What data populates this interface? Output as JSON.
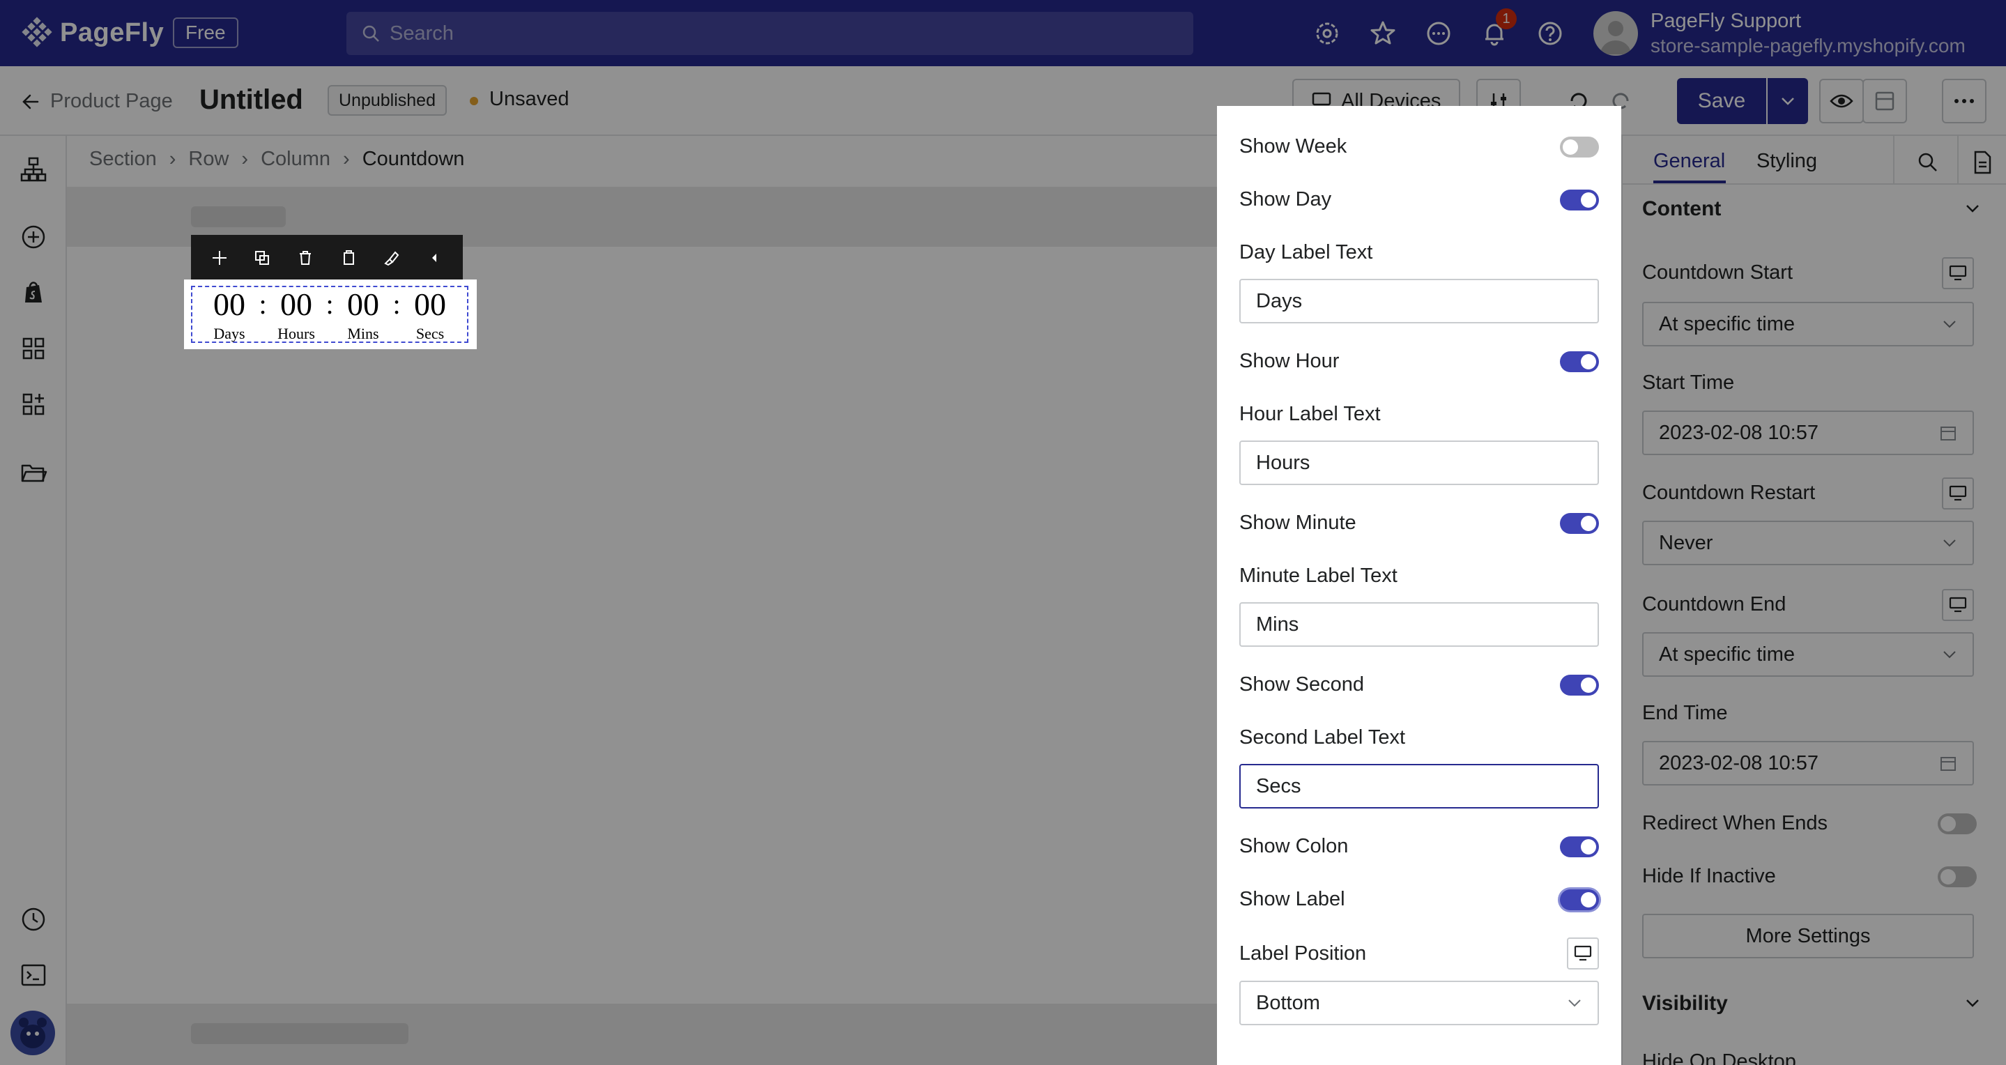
{
  "topbar": {
    "logo_text": "PageFly",
    "plan_badge": "Free",
    "search_placeholder": "Search",
    "notification_count": "1",
    "user_name": "PageFly Support",
    "user_store": "store-sample-pagefly.myshopify.com"
  },
  "subbar": {
    "back_label": "Product Page",
    "page_title": "Untitled",
    "status": "Unpublished",
    "save_state": "Unsaved",
    "devices_label": "All Devices",
    "save_label": "Save"
  },
  "breadcrumb": [
    "Section",
    "Row",
    "Column",
    "Countdown"
  ],
  "countdown": {
    "units": [
      {
        "value": "00",
        "label": "Days"
      },
      {
        "value": "00",
        "label": "Hours"
      },
      {
        "value": "00",
        "label": "Mins"
      },
      {
        "value": "00",
        "label": "Secs"
      }
    ],
    "separator": ":"
  },
  "popover": {
    "show_week": "Show Week",
    "show_day": "Show Day",
    "day_label_text": "Day Label Text",
    "day_value": "Days",
    "show_hour": "Show Hour",
    "hour_label_text": "Hour Label Text",
    "hour_value": "Hours",
    "show_minute": "Show Minute",
    "minute_label_text": "Minute Label Text",
    "minute_value": "Mins",
    "show_second": "Show Second",
    "second_label_text": "Second Label Text",
    "second_value": "Secs",
    "show_colon": "Show Colon",
    "show_label": "Show Label",
    "label_position": "Label Position",
    "label_position_value": "Bottom"
  },
  "rightpanel": {
    "tab_general": "General",
    "tab_styling": "Styling",
    "content_heading": "Content",
    "countdown_start_label": "Countdown Start",
    "countdown_start_value": "At specific time",
    "start_time_label": "Start Time",
    "start_time_value": "2023-02-08 10:57",
    "countdown_restart_label": "Countdown Restart",
    "countdown_restart_value": "Never",
    "countdown_end_label": "Countdown End",
    "countdown_end_value": "At specific time",
    "end_time_label": "End Time",
    "end_time_value": "2023-02-08 10:57",
    "redirect_label": "Redirect When Ends",
    "hide_inactive_label": "Hide If Inactive",
    "more_settings": "More Settings",
    "visibility_heading": "Visibility",
    "hide_desktop_label": "Hide On Desktop"
  },
  "colors": {
    "brand": "#262a8f",
    "toggle_on": "#3f44b5",
    "toggle_off": "#bdbdbd",
    "unsaved_dot": "#e8a530",
    "notification": "#d72c0d"
  }
}
